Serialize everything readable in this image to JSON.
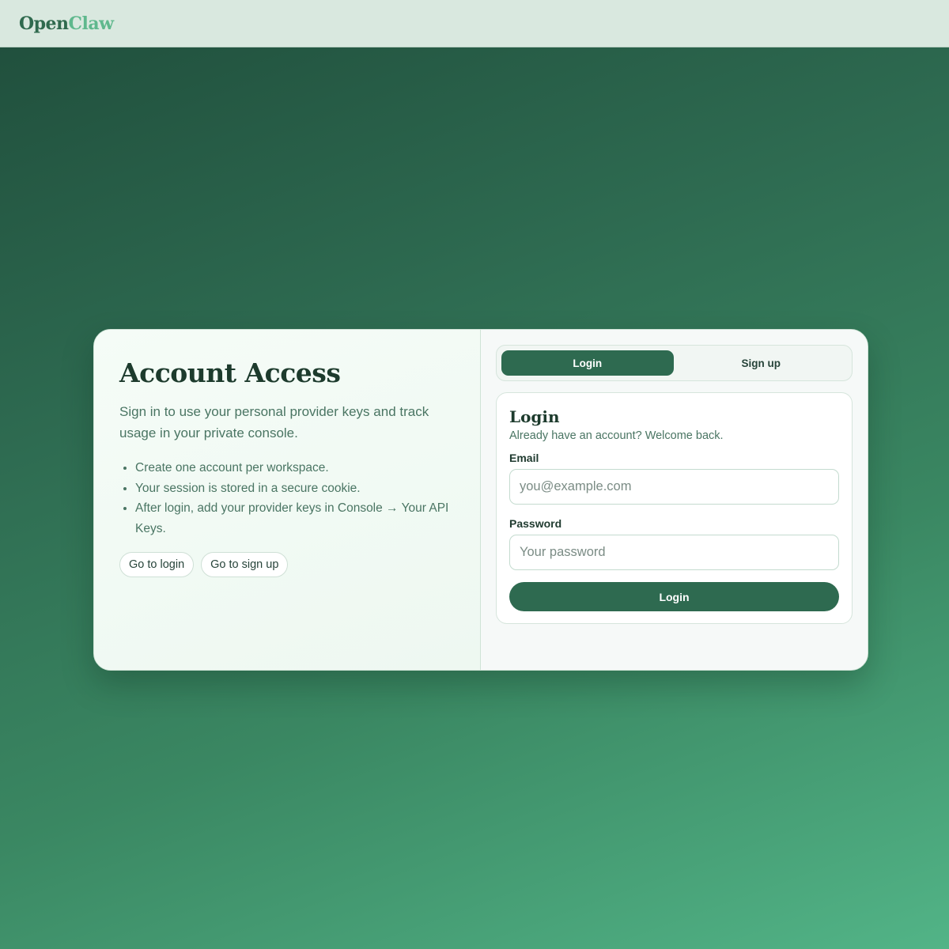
{
  "header": {
    "brand_part1": "Open",
    "brand_part2": "Claw"
  },
  "info_panel": {
    "title": "Account Access",
    "intro": "Sign in to use your personal provider keys and track usage in your private console.",
    "bullets": [
      "Create one account per workspace.",
      "Your session is stored in a secure cookie.",
      "After login, add your provider keys in Console → Your API Keys."
    ],
    "go_login_label": "Go to login",
    "go_signup_label": "Go to sign up"
  },
  "tabs": {
    "active": "login",
    "login_label": "Login",
    "signup_label": "Sign up"
  },
  "login_form": {
    "title": "Login",
    "subtitle": "Already have an account? Welcome back.",
    "email_label": "Email",
    "email_value": "",
    "email_placeholder": "you@example.com",
    "password_label": "Password",
    "password_value": "",
    "password_placeholder": "Your password",
    "submit_label": "Login"
  },
  "colors": {
    "brand_primary": "#2e6a50",
    "brand_accent": "#5fb88d",
    "heading": "#1d3b2d",
    "muted_text": "#4a7563"
  }
}
